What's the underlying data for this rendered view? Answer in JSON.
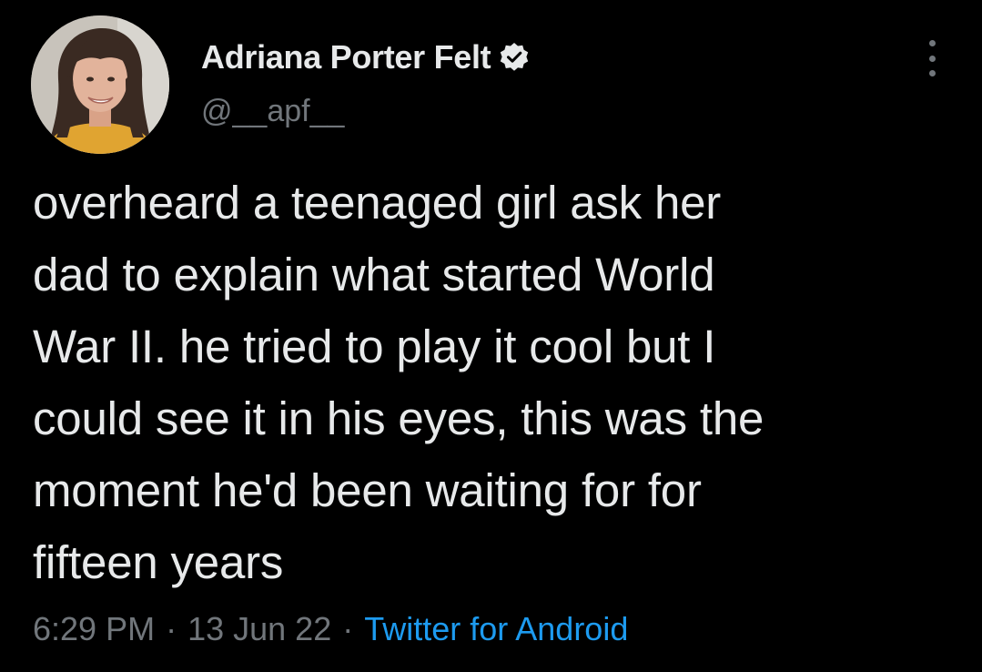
{
  "tweet": {
    "author": {
      "display_name": "Adriana Porter Felt",
      "handle": "@__apf__",
      "verified": true,
      "avatar_icon": "profile-photo"
    },
    "text_lines": [
      "overheard a teenaged girl ask her",
      "dad to explain what started World",
      "War II. he tried to play it cool but I",
      "could see it in his eyes, this was the",
      "moment he'd been waiting for for",
      "fifteen years"
    ],
    "meta": {
      "time": "6:29 PM",
      "separator": "·",
      "date": "13 Jun 22",
      "source": "Twitter for Android"
    },
    "more_icon": "more-options-icon"
  },
  "colors": {
    "background": "#000000",
    "primary_text": "#e7e9ea",
    "secondary_text": "#71767b",
    "accent": "#1d9bf0"
  }
}
